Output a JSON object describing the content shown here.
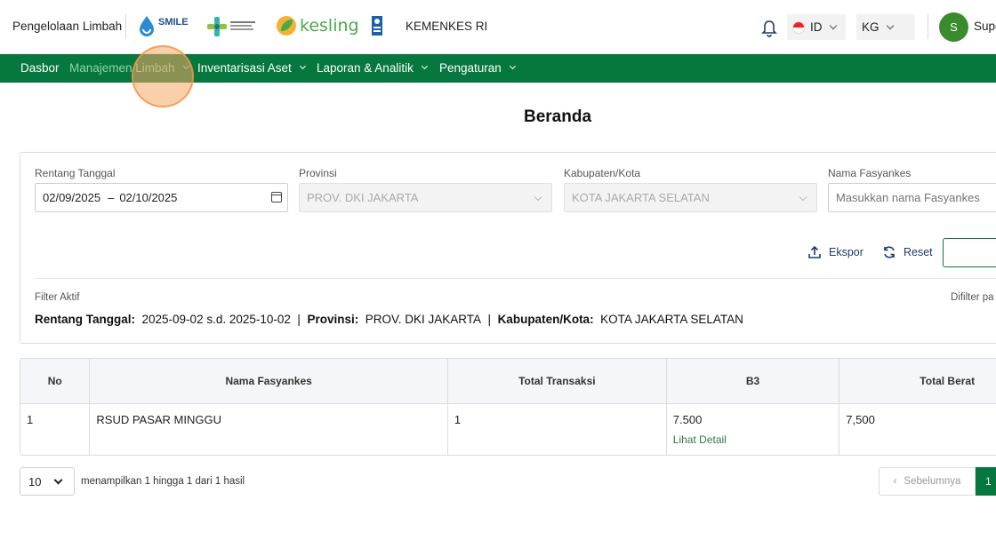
{
  "header": {
    "app_name": "Pengelolaan Limbah",
    "ministry": "KEMENKES RI",
    "language": "ID",
    "unit": "KG",
    "user_initial": "S",
    "user_name": "Supe",
    "logos": [
      "smile-logo",
      "kemenkes-logo",
      "kesling-logo",
      "undp-logo"
    ],
    "logo_texts": {
      "smile": "SMILE",
      "kesling": "kesling"
    }
  },
  "nav": {
    "items": [
      {
        "label": "Dasbor",
        "dropdown": false
      },
      {
        "label": "Manajemen Limbah",
        "dropdown": true
      },
      {
        "label": "Inventarisasi Aset",
        "dropdown": true
      },
      {
        "label": "Laporan & Analitik",
        "dropdown": true
      },
      {
        "label": "Pengaturan",
        "dropdown": true
      }
    ]
  },
  "page": {
    "title": "Beranda"
  },
  "filters": {
    "date_range": {
      "label": "Rentang Tanggal",
      "start": "02/09/2025",
      "separator": "–",
      "end": "02/10/2025"
    },
    "province": {
      "label": "Provinsi",
      "value": "PROV. DKI JAKARTA"
    },
    "city": {
      "label": "Kabupaten/Kota",
      "value": "KOTA JAKARTA SELATAN"
    },
    "facility": {
      "label": "Nama Fasyankes",
      "placeholder": "Masukkan nama Fasyankes"
    },
    "export_label": "Ekspor",
    "reset_label": "Reset",
    "active": {
      "title": "Filter Aktif",
      "right_note": "Difilter pa",
      "date_key": "Rentang Tanggal:",
      "date_value": "2025-09-02 s.d. 2025-10-02",
      "province_key": "Provinsi:",
      "province_value": "PROV. DKI JAKARTA",
      "city_key": "Kabupaten/Kota:",
      "city_value": "KOTA JAKARTA SELATAN",
      "sep": "|"
    }
  },
  "table": {
    "headers": [
      "No",
      "Nama Fasyankes",
      "Total Transaksi",
      "B3",
      "Total Berat"
    ],
    "rows": [
      {
        "no": "1",
        "name": "RSUD PASAR MINGGU",
        "transactions": "1",
        "b3": "7.500",
        "detail": "Lihat Detail",
        "total_weight": "7,500"
      }
    ]
  },
  "pagination": {
    "page_size": "10",
    "info": "menampilkan 1 hingga 1 dari 1 hasil",
    "prev_label": "Sebelumnya",
    "prev_icon": "‹",
    "current_page": "1"
  },
  "colors": {
    "primary": "#06773f",
    "nav_dim": "#8fd1ad",
    "link": "#1d3b6b",
    "avatar": "#3a8a2e"
  }
}
